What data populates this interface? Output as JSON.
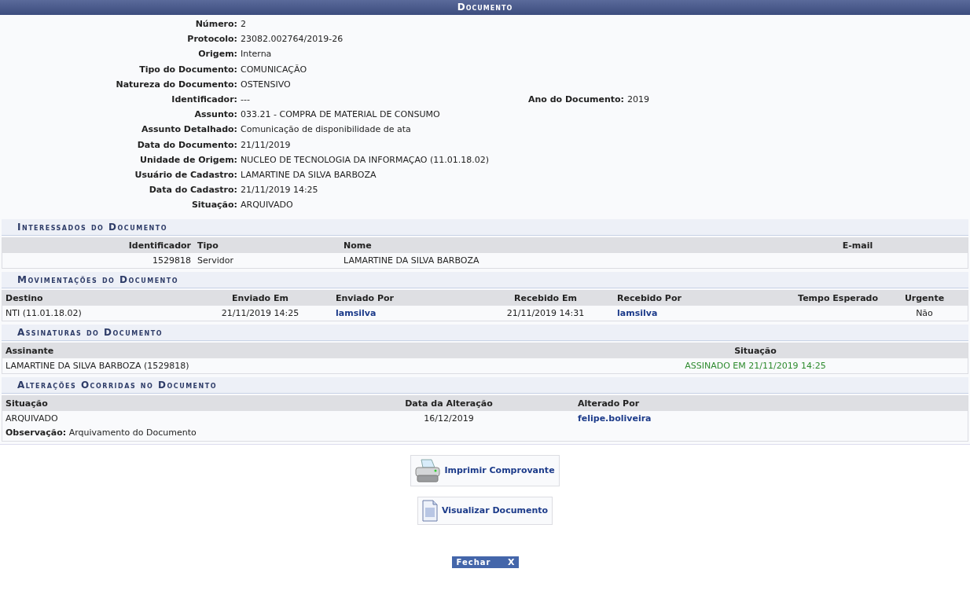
{
  "title": "Documento",
  "fields": [
    {
      "label": "Número:",
      "value": "2"
    },
    {
      "label": "Protocolo:",
      "value": "23082.002764/2019-26"
    },
    {
      "label": "Origem:",
      "value": "Interna"
    },
    {
      "label": "Tipo do Documento:",
      "value": "COMUNICAÇÃO"
    },
    {
      "label": "Natureza do Documento:",
      "value": "OSTENSIVO"
    },
    {
      "label": "Identificador:",
      "value": "---",
      "extra_label": "Ano do Documento:",
      "extra_value": "2019"
    },
    {
      "label": "Assunto:",
      "value": "033.21 - COMPRA DE MATERIAL DE CONSUMO"
    },
    {
      "label": "Assunto Detalhado:",
      "value": "Comunicação de disponibilidade de ata"
    },
    {
      "label": "Data do Documento:",
      "value": "21/11/2019"
    },
    {
      "label": "Unidade de Origem:",
      "value": "NUCLEO DE TECNOLOGIA DA INFORMAÇAO (11.01.18.02)"
    },
    {
      "label": "Usuário de Cadastro:",
      "value": "LAMARTINE DA SILVA BARBOZA"
    },
    {
      "label": "Data do Cadastro:",
      "value": "21/11/2019 14:25"
    },
    {
      "label": "Situação:",
      "value": "ARQUIVADO"
    }
  ],
  "interessados": {
    "title": "Interessados do Documento",
    "columns": [
      "Identificador",
      "Tipo",
      "Nome",
      "E-mail"
    ],
    "rows": [
      [
        "1529818",
        "Servidor",
        "LAMARTINE DA SILVA BARBOZA"
      ]
    ]
  },
  "movimentacoes": {
    "title": "Movimentações do Documento",
    "columns": [
      "Destino",
      "Enviado Em",
      "Enviado Por",
      "Recebido Em",
      "Recebido Por",
      "Tempo Esperado",
      "Urgente"
    ],
    "rows": [
      [
        "NTI (11.01.18.02)",
        "21/11/2019 14:25",
        "lamsilva",
        "21/11/2019 14:31",
        "lamsilva",
        "",
        "Não"
      ]
    ]
  },
  "assinaturas": {
    "title": "Assinaturas do Documento",
    "columns": [
      "Assinante",
      "Situação"
    ],
    "rows": [
      [
        "LAMARTINE DA SILVA BARBOZA (1529818)",
        "ASSINADO EM 21/11/2019 14:25"
      ]
    ]
  },
  "alteracoes": {
    "title": "Alterações Ocorridas no Documento",
    "columns": [
      "Situação",
      "Data da Alteração",
      "Alterado Por"
    ],
    "rows": [
      {
        "cells": [
          "ARQUIVADO",
          "16/12/2019",
          "felipe.boliveira"
        ],
        "note": "**Observação:** Arquivamento do Documento"
      }
    ]
  },
  "actions": [
    {
      "kind": "print",
      "label": "Imprimir Comprovante"
    },
    {
      "kind": "view",
      "label": "Visualizar Documento"
    }
  ],
  "close_button": {
    "label": "Fechar",
    "icon": "X"
  }
}
